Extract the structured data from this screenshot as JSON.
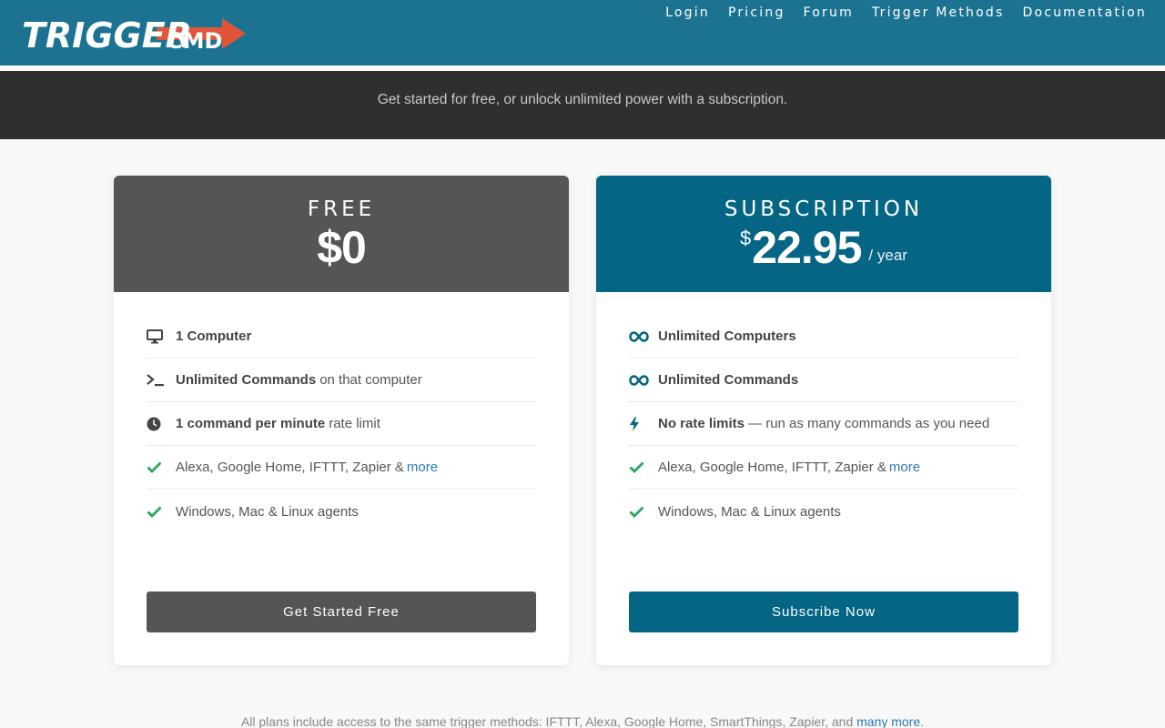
{
  "brand": {
    "logo_text_main": "TRIGGER",
    "logo_text_sub": "CMD",
    "logo_arrow_color": "#e0553a"
  },
  "nav": {
    "links": [
      {
        "label": "Login"
      },
      {
        "label": "Pricing"
      },
      {
        "label": "Forum"
      },
      {
        "label": "Trigger Methods"
      },
      {
        "label": "Documentation"
      }
    ]
  },
  "subhero": {
    "text": "Get started for free, or unlock unlimited power with a subscription."
  },
  "plans": {
    "free": {
      "name": "FREE",
      "price": "$0",
      "color": "#555555",
      "features": [
        {
          "icon": "monitor-icon",
          "bold": "1 Computer",
          "rest": ""
        },
        {
          "icon": "terminal-icon",
          "bold": "Unlimited Commands",
          "rest": "on that computer"
        },
        {
          "icon": "clock-icon",
          "bold": "1 command per minute",
          "rest": "rate limit"
        },
        {
          "icon": "check-icon",
          "bold": "",
          "rest": "Alexa, Google Home, IFTTT, Zapier &",
          "link": "more"
        },
        {
          "icon": "check-icon",
          "bold": "",
          "rest": "Windows, Mac & Linux agents"
        }
      ],
      "cta": "Get Started Free"
    },
    "subscription": {
      "name": "SUBSCRIPTION",
      "currency": "$",
      "price": "22.95",
      "period": "/ year",
      "color": "#046585",
      "features": [
        {
          "icon": "infinity-icon",
          "bold": "Unlimited Computers",
          "rest": ""
        },
        {
          "icon": "infinity-icon",
          "bold": "Unlimited Commands",
          "rest": ""
        },
        {
          "icon": "bolt-icon",
          "bold": "No rate limits",
          "rest": "— run as many commands as you need"
        },
        {
          "icon": "check-icon",
          "bold": "",
          "rest": "Alexa, Google Home, IFTTT, Zapier &",
          "link": "more"
        },
        {
          "icon": "check-icon",
          "bold": "",
          "rest": "Windows, Mac & Linux agents"
        }
      ],
      "cta": "Subscribe Now"
    }
  },
  "footer": {
    "note": "All plans include access to the same trigger methods: IFTTT, Alexa, Google Home, SmartThings, Zapier, and",
    "link": "many more",
    "end": "."
  },
  "colors": {
    "nav_bg": "#1c7391",
    "subhero_bg": "#2f2f31",
    "check_green": "#27a85f",
    "link_blue": "#2a7ab0"
  }
}
